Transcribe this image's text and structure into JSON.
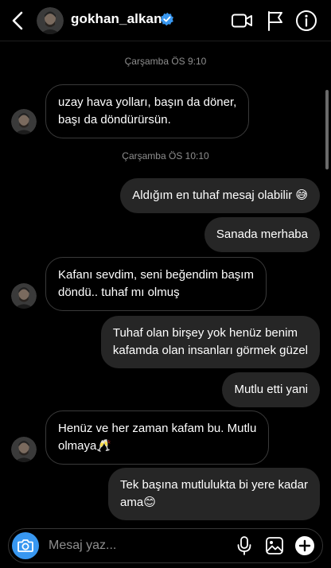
{
  "header": {
    "username": "gokhan_alkan",
    "icons": [
      "back-arrow-icon",
      "avatar",
      "verified-badge-icon",
      "video-camera-icon",
      "flag-icon",
      "info-icon"
    ]
  },
  "messages": [
    {
      "type": "timestamp",
      "text": "Çarşamba ÖS 9:10"
    },
    {
      "type": "received",
      "lines": [
        "uzay hava yolları, başın da döner,",
        "başı da döndürürsün."
      ]
    },
    {
      "type": "timestamp",
      "text": "Çarşamba ÖS 10:10"
    },
    {
      "type": "sent",
      "lines": [
        "Aldığım en tuhaf mesaj olabilir 😅"
      ]
    },
    {
      "type": "sent",
      "lines": [
        "Sanada merhaba"
      ]
    },
    {
      "type": "received",
      "lines": [
        "Kafanı sevdim, seni beğendim başım",
        "döndü.. tuhaf mı olmuş"
      ]
    },
    {
      "type": "sent",
      "lines": [
        "Tuhaf olan birşey yok henüz benim",
        "kafamda olan insanları görmek güzel"
      ]
    },
    {
      "type": "sent",
      "lines": [
        "Mutlu etti yani"
      ]
    },
    {
      "type": "received",
      "lines": [
        "Henüz ve her zaman kafam bu. Mutlu",
        "olmaya🥂"
      ]
    },
    {
      "type": "sent",
      "lines": [
        "Tek başına mutlulukta bi yere kadar",
        "ama😊"
      ]
    }
  ],
  "composer": {
    "placeholder": "Mesaj yaz...",
    "icons": [
      "camera-icon",
      "microphone-icon",
      "gallery-icon",
      "add-icon"
    ]
  },
  "colors": {
    "background": "#000000",
    "sent_bubble": "#262626",
    "received_border": "#3a3a3a",
    "camera_button": "#3897f0",
    "verified": "#3897f0",
    "timestamp": "#8e8e8e"
  }
}
